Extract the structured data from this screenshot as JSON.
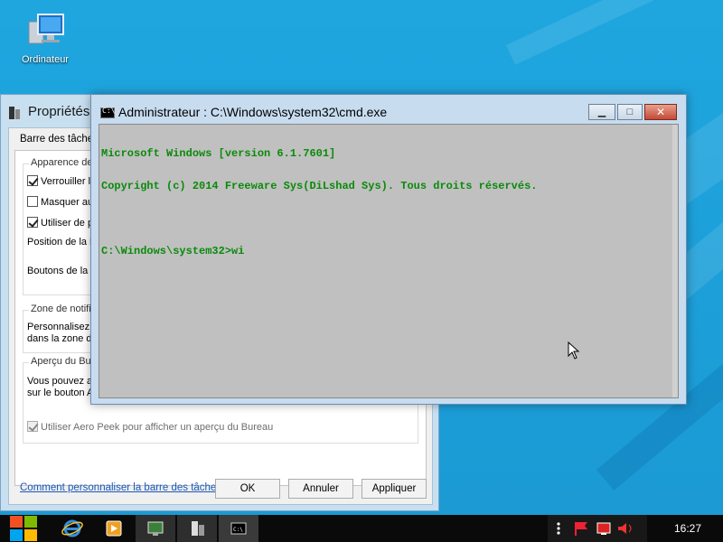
{
  "desktop": {
    "icons": [
      {
        "label": "Ordinateur",
        "icon": "computer-icon"
      }
    ]
  },
  "taskbar_properties": {
    "title": "Propriétés",
    "tab": "Barre des tâches",
    "appearance_group": "Apparence de",
    "chk_lock": "Verrouiller la",
    "chk_hide": "Masquer au",
    "chk_small": "Utiliser de pe",
    "position_label": "Position de la ba",
    "buttons_label": "Boutons de la b",
    "notif_group": "Zone de notific",
    "notif_line1": "Personnalisez l",
    "notif_line2": "dans la zone de",
    "peek_group": "Aperçu du Bure",
    "peek_line1": "Vous pouvez a",
    "peek_line2": "sur le bouton A",
    "chk_aero_peek": "Utiliser Aero Peek pour afficher un aperçu du Bureau",
    "help_link": "Comment personnaliser la barre des tâches ?",
    "btn_ok": "OK",
    "btn_cancel": "Annuler",
    "btn_apply": "Appliquer"
  },
  "cmd_window": {
    "title": "Administrateur : C:\\Windows\\system32\\cmd.exe",
    "icon": "cmd-icon",
    "minimize_glyph": "▁",
    "maximize_glyph": "□",
    "close_glyph": "✕",
    "lines": [
      "Microsoft Windows [version 6.1.7601]",
      "Copyright (c) 2014 Freeware Sys(DiLshad Sys). Tous droits réservés.",
      "",
      "C:\\Windows\\system32>wi"
    ]
  },
  "taskbar": {
    "start": "windows-logo-icon",
    "items": [
      "internet-explorer-icon",
      "media-player-icon",
      "network-window-icon",
      "properties-window-icon",
      "cmd-window-icon"
    ],
    "tray_icons": [
      "more-icon",
      "flag-icon",
      "display-icon",
      "volume-icon"
    ],
    "clock": "16:27"
  },
  "colors": {
    "desktop": "#1d9fd8",
    "console_bg": "#c0c0c0",
    "console_text": "#0a8a0a",
    "taskbar": "#0a0a0a"
  }
}
